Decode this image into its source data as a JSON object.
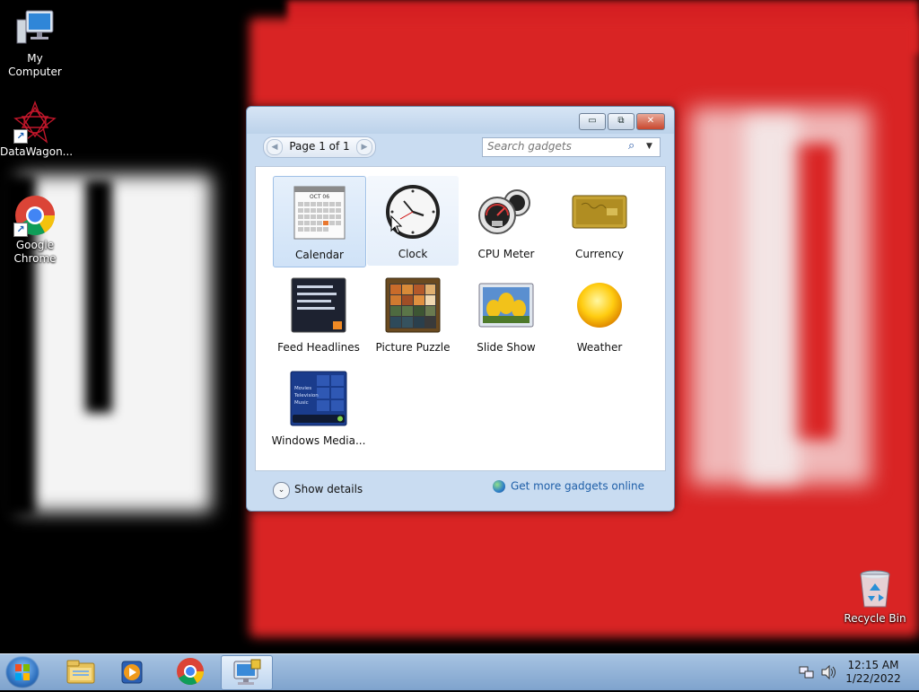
{
  "desktop": {
    "icons": [
      {
        "label": "My Computer",
        "icon": "computer-icon"
      },
      {
        "label": "DataWagon...",
        "icon": "datawagon-icon"
      },
      {
        "label": "Google Chrome",
        "icon": "chrome-icon"
      },
      {
        "label": "Recycle Bin",
        "icon": "recycle-bin-icon"
      }
    ]
  },
  "gadgets_window": {
    "caption_buttons": {
      "minimize": "▭",
      "restore": "⧉",
      "close": "✕"
    },
    "pager": {
      "text": "Page 1 of 1",
      "prev": "◀",
      "next": "▶"
    },
    "search": {
      "placeholder": "Search gadgets",
      "icon": "⌕",
      "dropdown": "▼"
    },
    "gadgets": [
      {
        "name": "Calendar",
        "state": "selected",
        "icon": "calendar-icon",
        "month": "OCT 06"
      },
      {
        "name": "Clock",
        "state": "hover",
        "icon": "clock-icon"
      },
      {
        "name": "CPU Meter",
        "state": "normal",
        "icon": "cpu-meter-icon"
      },
      {
        "name": "Currency",
        "state": "normal",
        "icon": "currency-icon"
      },
      {
        "name": "Feed Headlines",
        "state": "normal",
        "icon": "feed-headlines-icon"
      },
      {
        "name": "Picture Puzzle",
        "state": "normal",
        "icon": "picture-puzzle-icon"
      },
      {
        "name": "Slide Show",
        "state": "normal",
        "icon": "slide-show-icon"
      },
      {
        "name": "Weather",
        "state": "normal",
        "icon": "weather-icon"
      },
      {
        "name": "Windows Media...",
        "state": "normal",
        "icon": "windows-media-icon",
        "menu": [
          "Movies",
          "Television",
          "Music"
        ]
      }
    ],
    "footer": {
      "show_details": "Show details",
      "show_details_icon": "⌄",
      "get_more": "Get more gadgets online"
    }
  },
  "taskbar": {
    "pinned": [
      "file-explorer-icon",
      "media-player-icon",
      "chrome-icon",
      "remote-desktop-icon"
    ],
    "clock": {
      "time": "12:15 AM",
      "date": "1/22/2022"
    }
  },
  "colors": {
    "accent": "#1f5fa8",
    "taskbar": "#8fb0d6",
    "wallpaper_red": "#d92424"
  }
}
